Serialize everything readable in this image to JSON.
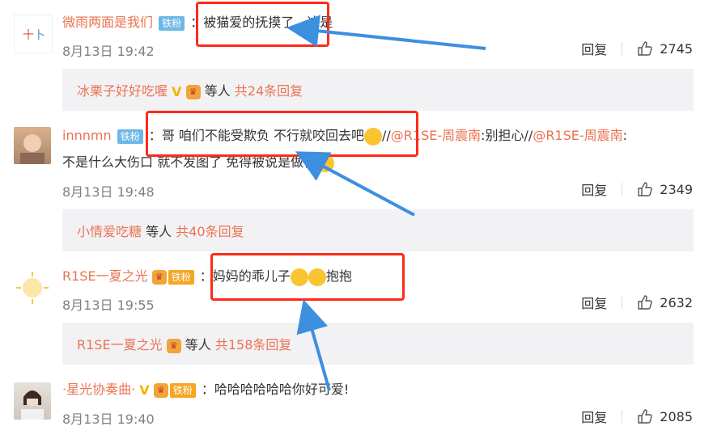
{
  "comments": [
    {
      "username": "微雨两面是我们",
      "badge": "铁粉",
      "text": "被猫爱的抚摸了，这是",
      "time": "8月13日 19:42",
      "reply_label": "回复",
      "likes": "2745",
      "reply_preview": {
        "user": "冰栗子好好吃喔",
        "middle": "等人",
        "count_text": "共24条回复"
      }
    },
    {
      "username": "innnmn",
      "badge": "铁粉",
      "text_part1": "哥 咱们不能受欺负 不行就咬回去吧",
      "sep1": "//",
      "mention1": "@R1SE-周震南",
      "text_part2": ":别担心//",
      "mention2": "@R1SE-周震南",
      "text_part3": ":",
      "text_line2": "不是什么大伤口 就不发图了 免得被说是做作",
      "time": "8月13日 19:48",
      "reply_label": "回复",
      "likes": "2349",
      "reply_preview": {
        "user": "小情爱吃糖",
        "middle": "等人",
        "count_text": "共40条回复"
      }
    },
    {
      "username": "R1SE一夏之光",
      "badge": "铁粉",
      "text_a": "妈妈的乖儿子",
      "text_b": "抱抱",
      "time": "8月13日 19:55",
      "reply_label": "回复",
      "likes": "2632",
      "reply_preview": {
        "user": "R1SE一夏之光",
        "middle": "等人",
        "count_text": "共158条回复"
      }
    },
    {
      "username": "·星光协奏曲·",
      "badge": "铁粉",
      "text": "哈哈哈哈哈哈你好可爱!",
      "time": "8月13日 19:40",
      "reply_label": "回复",
      "likes": "2085"
    }
  ],
  "colors": {
    "highlight_box": "#ff2a1a",
    "arrow": "#3d8fe0",
    "username": "#eb7350"
  }
}
